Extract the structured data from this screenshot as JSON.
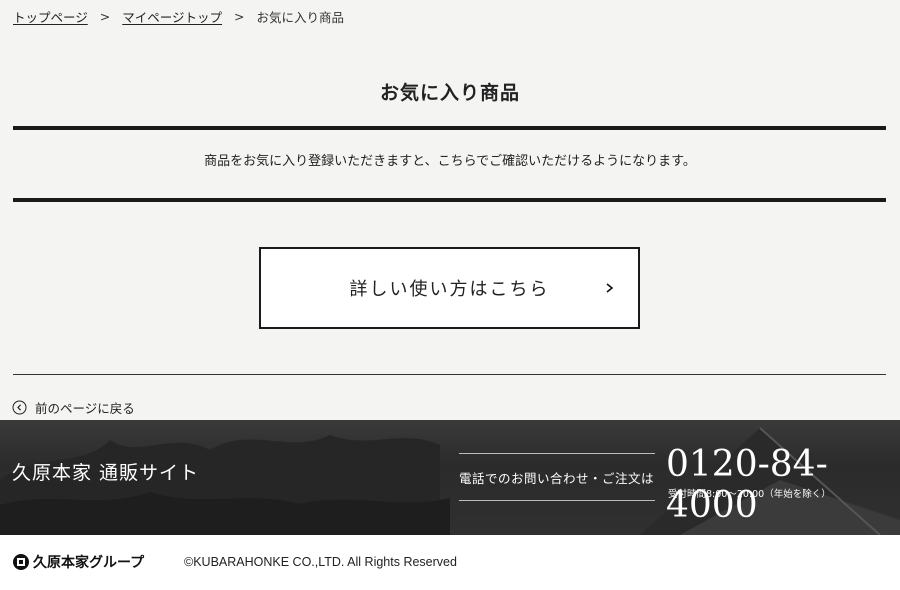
{
  "breadcrumb": {
    "items": [
      "トップページ",
      "マイページトップ"
    ],
    "current": "お気に入り商品",
    "separator": ">"
  },
  "page": {
    "title": "お気に入り商品",
    "notice": "商品をお気に入り登録いただきますと、こちらでご確認いただけるようになります。"
  },
  "how_to": {
    "label": "詳しい使い方はこちら",
    "icon": "chevron-right-icon"
  },
  "back": {
    "label": "前のページに戻る",
    "icon": "circle-chevron-left-icon"
  },
  "footer": {
    "site_name": "久原本家 通販サイト",
    "tel_label": "電話でのお問い合わせ・ご注文は",
    "tel_number": "0120-84-4000",
    "tel_hours": "受付時間8:00〜20:00（年始を除く）"
  },
  "bottom": {
    "group_logo": "久原本家グループ",
    "copyright": "©KUBARAHONKE CO.,LTD. All Rights Reserved"
  },
  "colors": {
    "background": "#f4f4f2",
    "rule": "#1a1a1a",
    "footer_band": "#303030",
    "bottom_bar": "#ffffff"
  }
}
